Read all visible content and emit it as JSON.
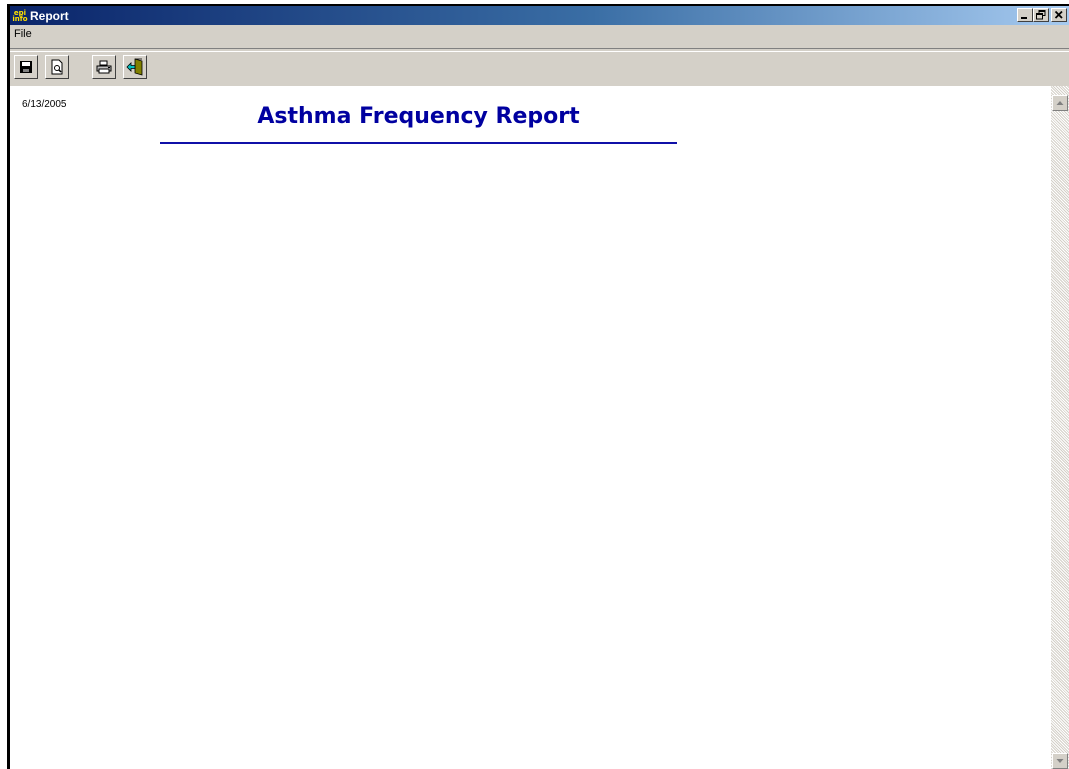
{
  "window": {
    "title": "Report",
    "icon_top": "epi",
    "icon_bottom": "info"
  },
  "title_buttons": {
    "minimize": "_",
    "restore": "❐",
    "close": "×"
  },
  "menubar": {
    "items": [
      {
        "label": "File"
      }
    ]
  },
  "toolbar": {
    "buttons": [
      {
        "name": "save",
        "icon": "floppy-disk-icon"
      },
      {
        "name": "print-preview",
        "icon": "print-preview-icon"
      },
      {
        "name": "print",
        "icon": "printer-icon"
      },
      {
        "name": "exit",
        "icon": "exit-door-icon"
      }
    ]
  },
  "report": {
    "date": "6/13/2005",
    "title": "Asthma Frequency Report"
  },
  "colors": {
    "title_blue": "#0000a0",
    "titlebar_start": "#0a246a",
    "titlebar_end": "#a6caf0",
    "chrome": "#d4d0c8"
  }
}
